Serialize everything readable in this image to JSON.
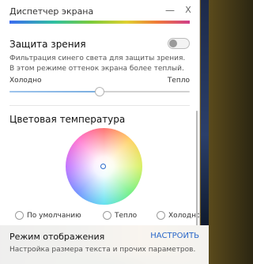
{
  "window": {
    "title": "Диспетчер экрана",
    "minimize_glyph": "—",
    "close_glyph": "X"
  },
  "eye_protection": {
    "title": "Защита зрения",
    "enabled": false,
    "description_line1": "Фильтрация синего света для защиты зрения.",
    "description_line2": "В этом режиме оттенок экрана более теплый.",
    "range_min_label": "Холодно",
    "range_max_label": "Тепло",
    "level": 0.5
  },
  "color_temperature": {
    "title": "Цветовая температура",
    "options": [
      {
        "label": "По умолчанию",
        "selected": false
      },
      {
        "label": "Тепло",
        "selected": false
      },
      {
        "label": "Холодно",
        "selected": false
      }
    ]
  },
  "display_mode": {
    "title": "Режим отображения",
    "action_label": "НАСТРОИТЬ",
    "description": "Настройка размера текста и прочих параметров."
  },
  "colors": {
    "accent": "#2a68c9",
    "slider_fill": "#7aaee0"
  }
}
